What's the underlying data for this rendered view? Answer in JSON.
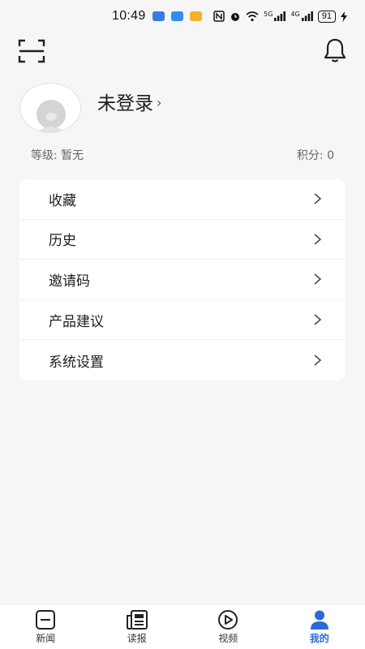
{
  "status_bar": {
    "time": "10:49",
    "network_5g_label": "5G",
    "network_4g_label": "4G",
    "battery_level": "91",
    "app_icon_colors": [
      "#3a7be0",
      "#2f8ef0",
      "#f0b429"
    ]
  },
  "profile": {
    "login_label": "未登录",
    "level_label": "等级: 暂无",
    "points_label": "积分: 0"
  },
  "menu": {
    "items": [
      {
        "label": "收藏"
      },
      {
        "label": "历史"
      },
      {
        "label": "邀请码"
      },
      {
        "label": "产品建议"
      },
      {
        "label": "系统设置"
      }
    ]
  },
  "tab_bar": {
    "tabs": [
      {
        "label": "新闻",
        "icon": "news-icon",
        "active": false
      },
      {
        "label": "读报",
        "icon": "newspaper-icon",
        "active": false
      },
      {
        "label": "视频",
        "icon": "video-play-icon",
        "active": false
      },
      {
        "label": "我的",
        "icon": "user-icon",
        "active": true
      }
    ]
  },
  "colors": {
    "accent": "#2b6bd6",
    "background": "#f6f6f7",
    "card": "#ffffff"
  }
}
